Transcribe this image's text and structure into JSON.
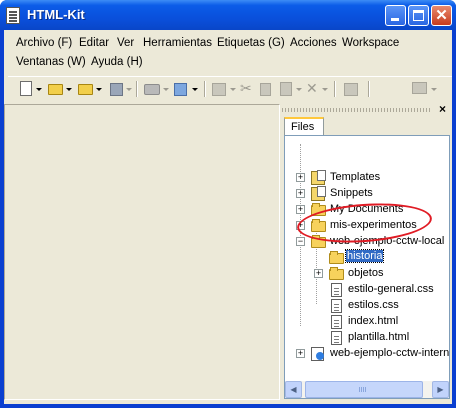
{
  "window": {
    "title": "HTML-Kit"
  },
  "menu": {
    "row1": [
      {
        "label": "Archivo",
        "hotkey": "(F)"
      },
      {
        "label": "Editar",
        "hotkey": ""
      },
      {
        "label": "Ver",
        "hotkey": ""
      },
      {
        "label": "Herramientas",
        "hotkey": ""
      },
      {
        "label": "Etiquetas",
        "hotkey": "(G)"
      },
      {
        "label": "Acciones",
        "hotkey": ""
      },
      {
        "label": "Workspace",
        "hotkey": ""
      }
    ],
    "row2": [
      {
        "label": "Ventanas",
        "hotkey": "(W)"
      },
      {
        "label": "Ayuda",
        "hotkey": "(H)"
      }
    ]
  },
  "toolbar": {
    "icons": [
      "new-document-icon",
      "open-folder-icon",
      "open-recent-folder-icon",
      "save-icon",
      "print-icon",
      "publish-icon",
      "preview-icon",
      "cut-icon",
      "copy-icon",
      "paste-icon",
      "delete-icon",
      "columns-icon",
      "monitor-icon"
    ]
  },
  "panel": {
    "close_glyph": "×",
    "tab_label": "Files"
  },
  "tree": {
    "items": [
      {
        "label": "Templates",
        "icon": "templates-icon",
        "expander": "+",
        "selected": false
      },
      {
        "label": "Snippets",
        "icon": "snippets-icon",
        "expander": "+",
        "selected": false
      },
      {
        "label": "My Documents",
        "icon": "folder-icon",
        "expander": "+",
        "selected": false
      },
      {
        "label": "mis-experimentos",
        "icon": "folder-icon",
        "expander": "+",
        "selected": false
      },
      {
        "label": "web-ejemplo-cctw-local",
        "icon": "folder-icon",
        "expander": "−",
        "selected": false
      },
      {
        "label": "historia",
        "icon": "folder-icon",
        "expander": "",
        "selected": true
      },
      {
        "label": "objetos",
        "icon": "folder-icon",
        "expander": "+",
        "selected": false
      },
      {
        "label": "estilo-general.css",
        "icon": "file-icon",
        "expander": "",
        "selected": false
      },
      {
        "label": "estilos.css",
        "icon": "file-icon",
        "expander": "",
        "selected": false
      },
      {
        "label": "index.html",
        "icon": "file-icon",
        "expander": "",
        "selected": false
      },
      {
        "label": "plantilla.html",
        "icon": "file-icon",
        "expander": "",
        "selected": false
      },
      {
        "label": "web-ejemplo-cctw-interne",
        "icon": "web-folder-icon",
        "expander": "+",
        "selected": false
      }
    ]
  },
  "scrollbar": {
    "left_arrow": "◀",
    "right_arrow": "▶"
  },
  "colors": {
    "titlebar": "#0b5ce8",
    "selection": "#316ac5",
    "annotation": "#e01b24"
  }
}
